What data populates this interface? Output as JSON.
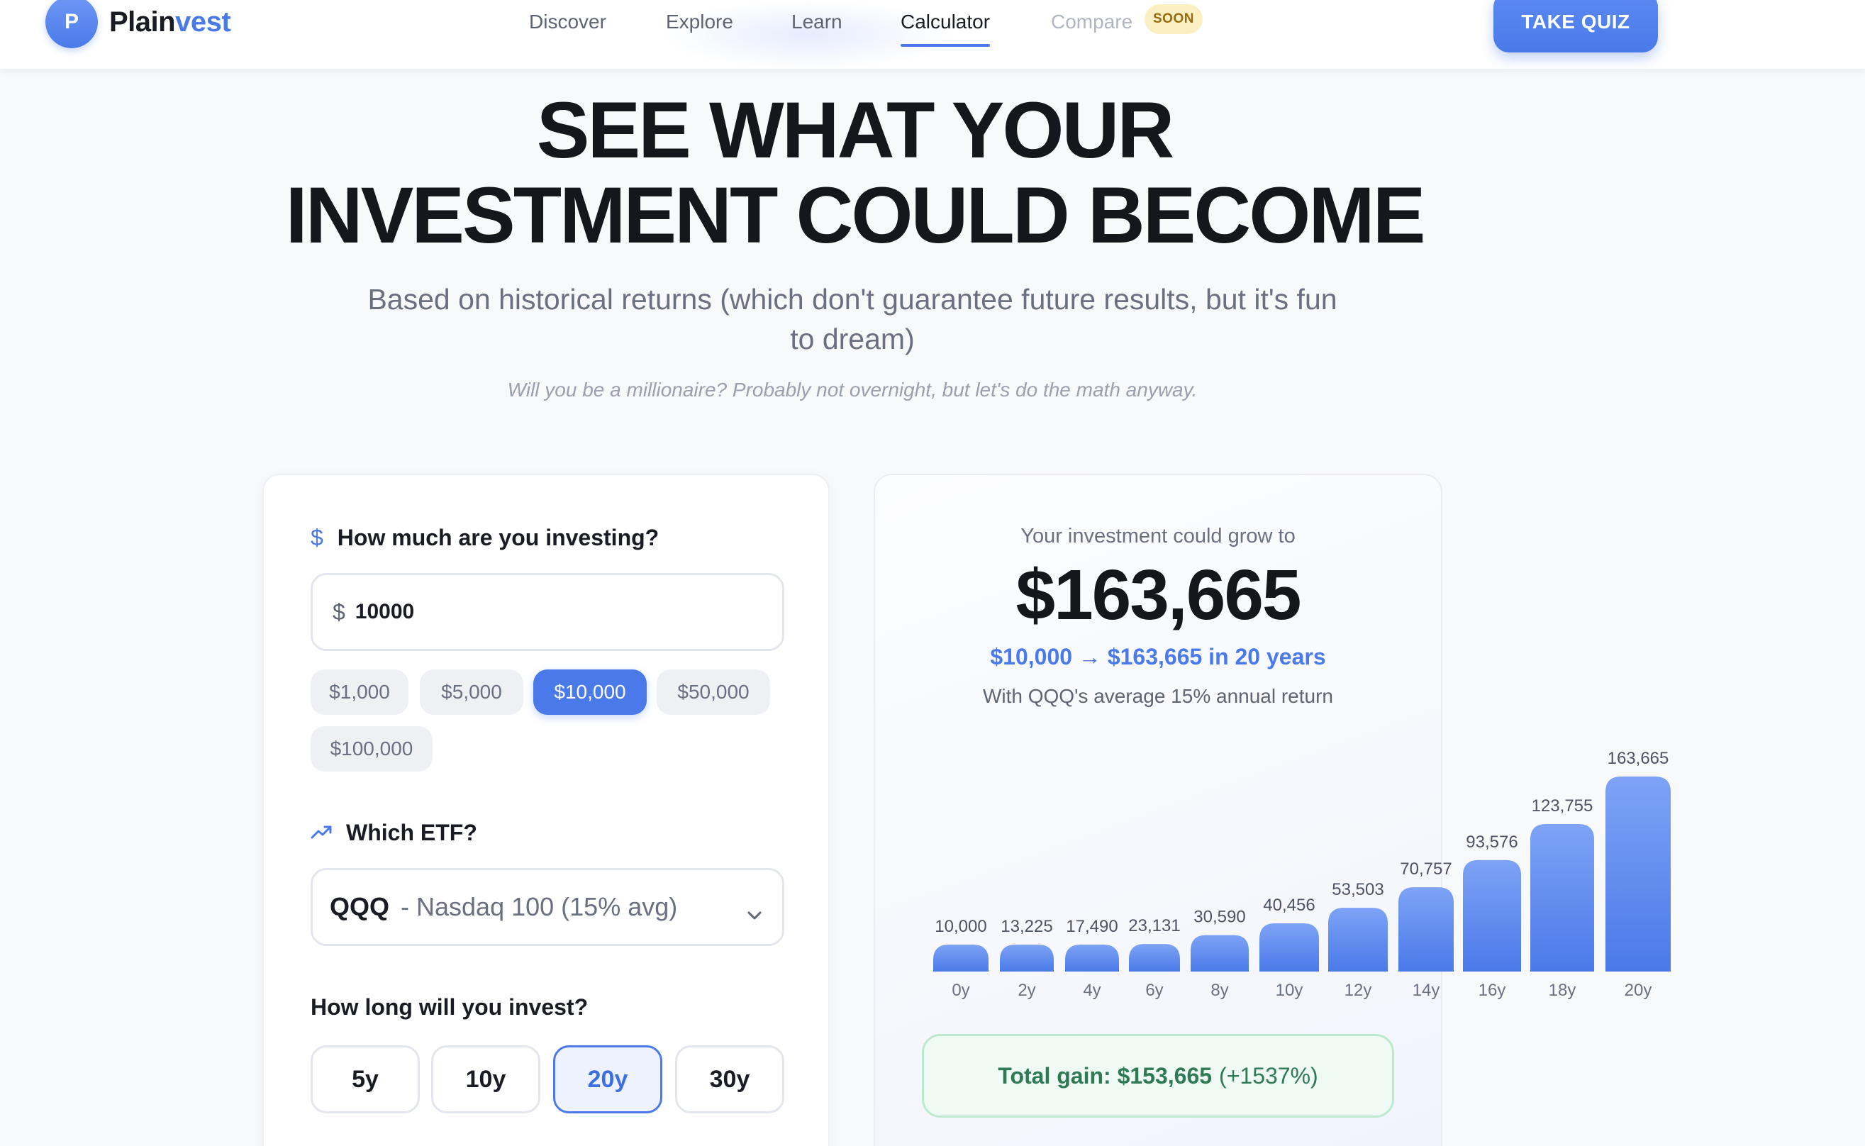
{
  "nav": {
    "logo_letter": "P",
    "logo_part1": "Plain",
    "logo_part2": "vest",
    "links": [
      {
        "label": "Discover"
      },
      {
        "label": "Explore"
      },
      {
        "label": "Learn"
      },
      {
        "label": "Calculator"
      },
      {
        "label": "Compare"
      }
    ],
    "soon_badge": "SOON",
    "quiz_button": "TAKE QUIZ"
  },
  "hero": {
    "title_line1": "SEE WHAT YOUR",
    "title_line2": "INVESTMENT COULD BECOME",
    "subtitle": "Based on historical returns (which don't guarantee future results, but it's fun to dream)",
    "note": "Will you be a millionaire? Probably not overnight, but let's do the math anyway."
  },
  "calculator": {
    "amount_label": "How much are you investing?",
    "amount_currency": "$",
    "amount_value": "10000",
    "presets": [
      "$1,000",
      "$5,000",
      "$10,000",
      "$50,000",
      "$100,000"
    ],
    "selected_preset": "$10,000",
    "etf_label": "Which ETF?",
    "etf_ticker": "QQQ",
    "etf_description": "- Nasdaq 100 (15% avg)",
    "duration_label": "How long will you invest?",
    "durations": [
      "5y",
      "10y",
      "20y",
      "30y"
    ],
    "selected_duration": "20y"
  },
  "result": {
    "grow_label": "Your investment could grow to",
    "final_value": "$163,665",
    "growth_summary": "$10,000 → $163,665 in 20 years",
    "return_note": "With QQQ's average 15% annual return",
    "gain_text": "Total gain: $153,665",
    "gain_pct": "(+1537%)"
  },
  "colors": {
    "accent": "#4a7ae9",
    "accent_light": "#7ea3f6",
    "gain_text": "#2f7a55",
    "gain_bg": "#eefaf3",
    "soon_bg": "#fbf0c4"
  },
  "chart_data": {
    "type": "bar",
    "categories": [
      "0y",
      "2y",
      "4y",
      "6y",
      "8y",
      "10y",
      "12y",
      "14y",
      "16y",
      "18y",
      "20y"
    ],
    "values": [
      10000,
      13225,
      17490,
      23131,
      30590,
      40456,
      53503,
      70757,
      93576,
      123755,
      163665
    ],
    "value_labels": [
      "10,000",
      "13,225",
      "17,490",
      "23,131",
      "30,590",
      "40,456",
      "53,503",
      "70,757",
      "93,576",
      "123,755",
      "163,665"
    ],
    "title": "",
    "xlabel": "",
    "ylabel": "",
    "grid": false
  }
}
